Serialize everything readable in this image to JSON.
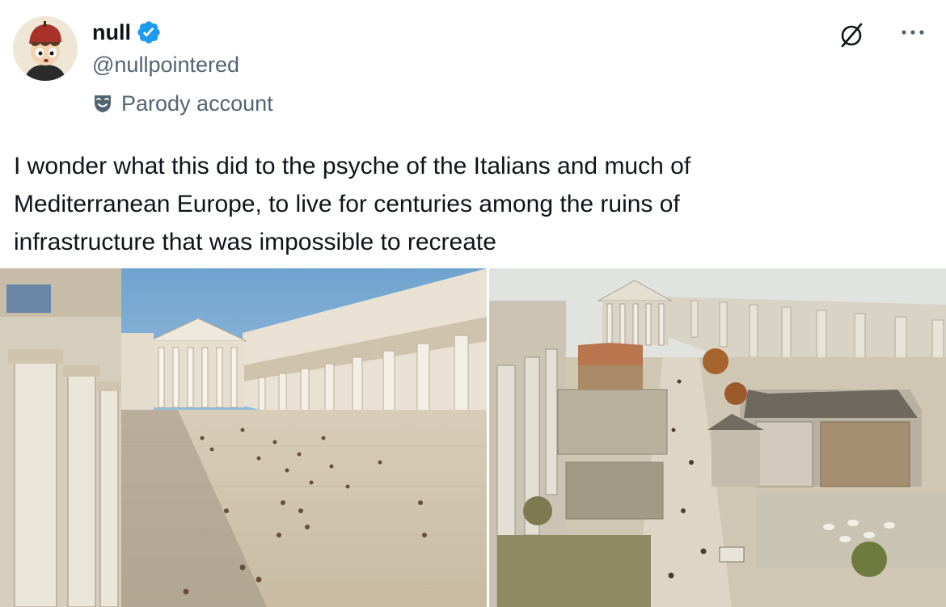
{
  "author": {
    "display_name": "null",
    "handle": "@nullpointered",
    "verified": true,
    "badge_label": "Parody account",
    "avatar_icon": "cartoon-boy-avatar",
    "verified_icon": "verified-badge-icon",
    "badge_icon": "theater-mask-icon"
  },
  "actions": {
    "grok_icon": "slashed-circle-icon",
    "more_icon": "more-horizontal-icon"
  },
  "post": {
    "text": "I wonder what this did to the psyche of the Italians and much of\nMediterranean Europe, to live for centuries among the ruins of\ninfrastructure that was impossible to recreate"
  },
  "media": [
    {
      "kind": "illustration",
      "subject": "roman-forum-reconstruction"
    },
    {
      "kind": "illustration",
      "subject": "medieval-settlement-in-ruins"
    }
  ],
  "colors": {
    "text_primary": "#0f1419",
    "text_secondary": "#536471",
    "verified_blue": "#1d9bf0"
  }
}
